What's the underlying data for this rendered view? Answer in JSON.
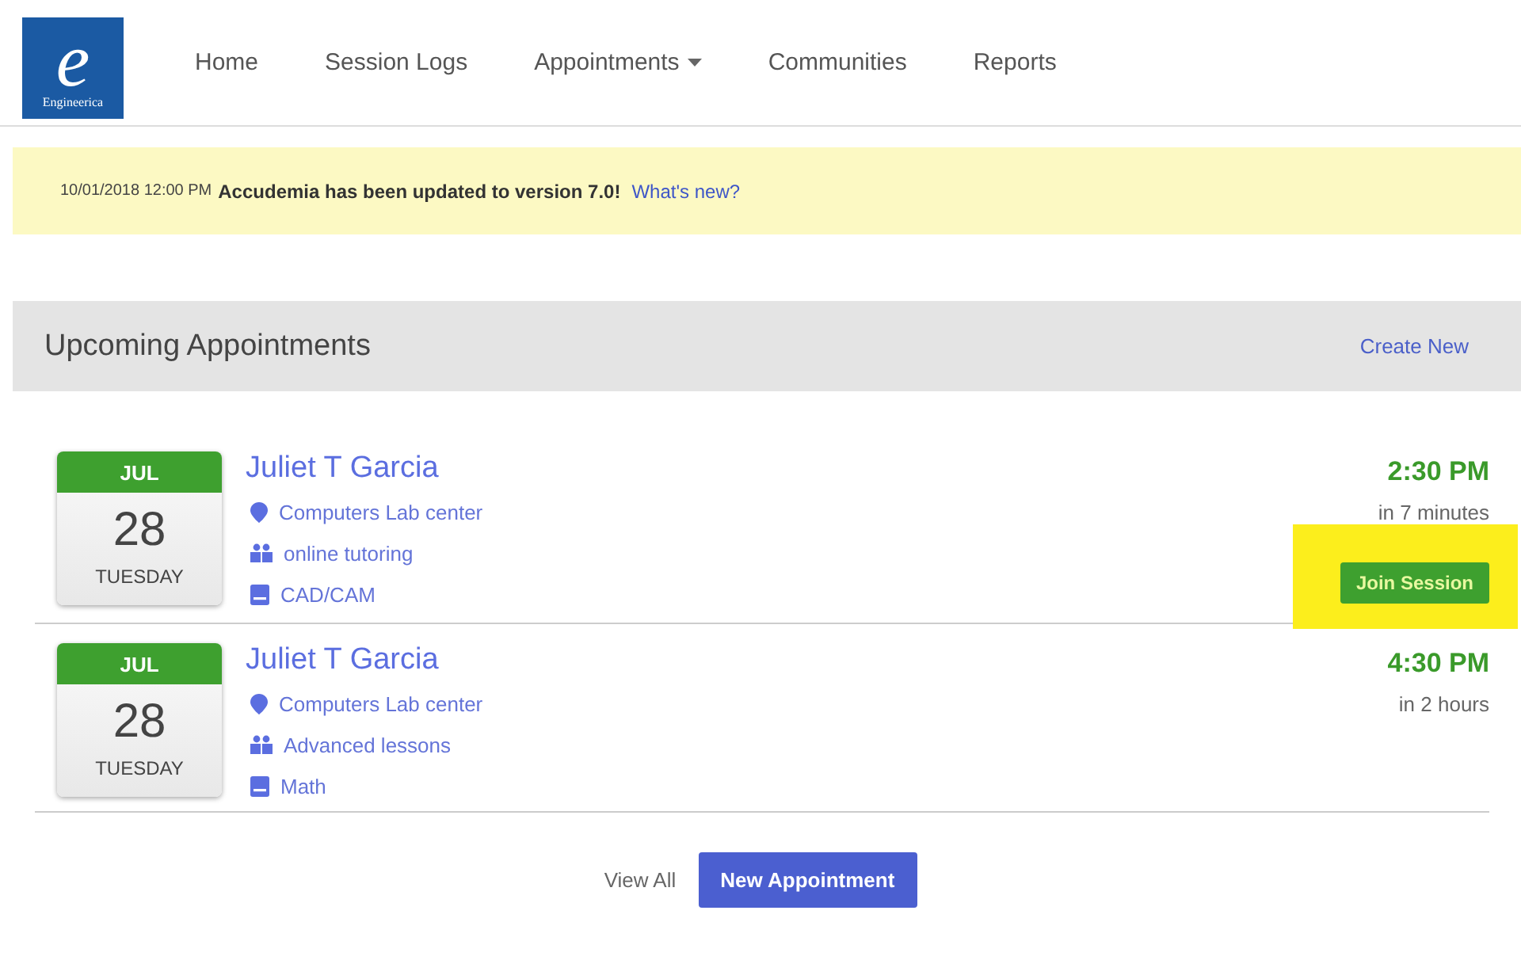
{
  "logo": {
    "letter": "e",
    "name": "Engineerica"
  },
  "nav": [
    {
      "label": "Home",
      "dropdown": false
    },
    {
      "label": "Session Logs",
      "dropdown": false
    },
    {
      "label": "Appointments",
      "dropdown": true
    },
    {
      "label": "Communities",
      "dropdown": false
    },
    {
      "label": "Reports",
      "dropdown": false
    }
  ],
  "notice": {
    "timestamp": "10/01/2018 12:00 PM",
    "message": "Accudemia has been updated to version 7.0!",
    "link": "What's new?"
  },
  "section": {
    "title": "Upcoming Appointments",
    "action": "Create New"
  },
  "appointments": [
    {
      "month": "JUL",
      "day": "28",
      "weekday": "TUESDAY",
      "name": "Juliet T Garcia",
      "location": "Computers Lab center",
      "service": "online tutoring",
      "subject": "CAD/CAM",
      "time": "2:30 PM",
      "relative": "in 7 minutes",
      "button": "Join Session",
      "highlighted": true
    },
    {
      "month": "JUL",
      "day": "28",
      "weekday": "TUESDAY",
      "name": "Juliet T Garcia",
      "location": "Computers Lab center",
      "service": "Advanced lessons",
      "subject": "Math",
      "time": "4:30 PM",
      "relative": "in 2 hours"
    }
  ],
  "footer": {
    "link": "View All",
    "button": "New Appointment"
  }
}
